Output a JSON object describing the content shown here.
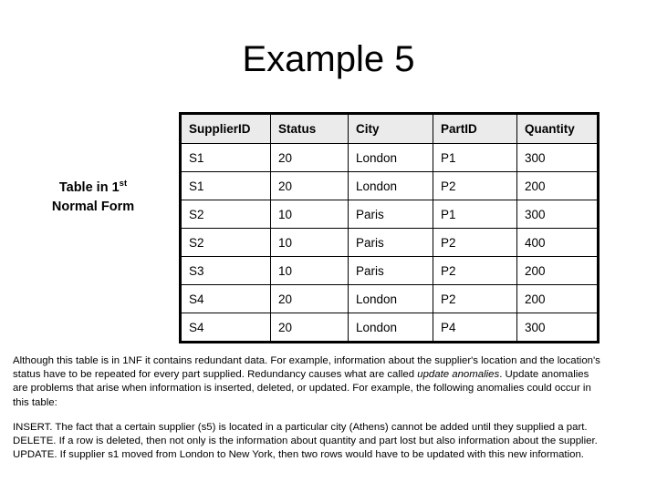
{
  "slide": {
    "title": "Example 5",
    "caption": {
      "line1_pre": "Table in 1",
      "line1_sup": "st",
      "line2": "Normal Form"
    }
  },
  "table": {
    "headers": [
      "SupplierID",
      "Status",
      "City",
      "PartID",
      "Quantity"
    ],
    "rows": [
      [
        "S1",
        "20",
        "London",
        "P1",
        "300"
      ],
      [
        "S1",
        "20",
        "London",
        "P2",
        "200"
      ],
      [
        "S2",
        "10",
        "Paris",
        "P1",
        "300"
      ],
      [
        "S2",
        "10",
        "Paris",
        "P2",
        "400"
      ],
      [
        "S3",
        "10",
        "Paris",
        "P2",
        "200"
      ],
      [
        "S4",
        "20",
        "London",
        "P2",
        "200"
      ],
      [
        "S4",
        "20",
        "London",
        "P4",
        "300"
      ]
    ],
    "header_background": "#ebebeb",
    "border_color": "#000000"
  },
  "paragraph_1": {
    "line1_a": "Although this table is in 1NF it contains redundant data. For example, information about the supplier's location and the location's",
    "line2_a": "status have to be repeated for every part supplied. Redundancy causes what are called ",
    "line2_em": "update anomalies",
    "line2_b": ". Update anomalies",
    "line3_a": "are problems that arise when information is inserted, deleted, or updated. For example, the following anomalies could occur in",
    "line4_a": "this table:"
  },
  "paragraph_2": {
    "line1": "INSERT. The fact that a certain supplier (s5) is located in a particular city (Athens) cannot be added until they supplied a part.",
    "line2": "DELETE. If a row is deleted, then not only is the information about quantity and part lost but also information about the supplier.",
    "line3": "UPDATE. If supplier s1 moved from London to New York, then two rows would have to be updated with this new information."
  }
}
